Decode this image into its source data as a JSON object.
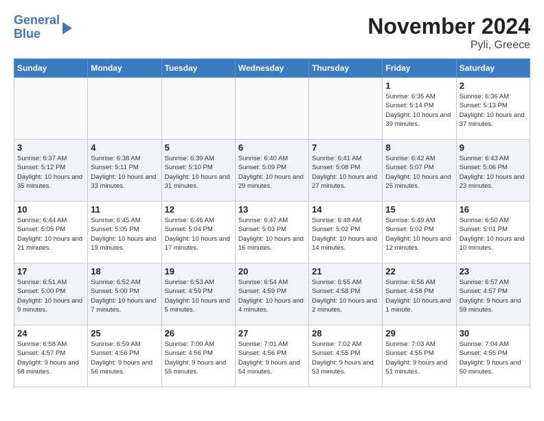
{
  "logo": {
    "line1": "General",
    "line2": "Blue"
  },
  "title": "November 2024",
  "subtitle": "Pyli, Greece",
  "days_of_week": [
    "Sunday",
    "Monday",
    "Tuesday",
    "Wednesday",
    "Thursday",
    "Friday",
    "Saturday"
  ],
  "weeks": [
    [
      {
        "day": "",
        "info": ""
      },
      {
        "day": "",
        "info": ""
      },
      {
        "day": "",
        "info": ""
      },
      {
        "day": "",
        "info": ""
      },
      {
        "day": "",
        "info": ""
      },
      {
        "day": "1",
        "info": "Sunrise: 6:35 AM\nSunset: 5:14 PM\nDaylight: 10 hours and 39 minutes."
      },
      {
        "day": "2",
        "info": "Sunrise: 6:36 AM\nSunset: 5:13 PM\nDaylight: 10 hours and 37 minutes."
      }
    ],
    [
      {
        "day": "3",
        "info": "Sunrise: 6:37 AM\nSunset: 5:12 PM\nDaylight: 10 hours and 35 minutes."
      },
      {
        "day": "4",
        "info": "Sunrise: 6:38 AM\nSunset: 5:11 PM\nDaylight: 10 hours and 33 minutes."
      },
      {
        "day": "5",
        "info": "Sunrise: 6:39 AM\nSunset: 5:10 PM\nDaylight: 10 hours and 31 minutes."
      },
      {
        "day": "6",
        "info": "Sunrise: 6:40 AM\nSunset: 5:09 PM\nDaylight: 10 hours and 29 minutes."
      },
      {
        "day": "7",
        "info": "Sunrise: 6:41 AM\nSunset: 5:08 PM\nDaylight: 10 hours and 27 minutes."
      },
      {
        "day": "8",
        "info": "Sunrise: 6:42 AM\nSunset: 5:07 PM\nDaylight: 10 hours and 25 minutes."
      },
      {
        "day": "9",
        "info": "Sunrise: 6:43 AM\nSunset: 5:06 PM\nDaylight: 10 hours and 23 minutes."
      }
    ],
    [
      {
        "day": "10",
        "info": "Sunrise: 6:44 AM\nSunset: 5:05 PM\nDaylight: 10 hours and 21 minutes."
      },
      {
        "day": "11",
        "info": "Sunrise: 6:45 AM\nSunset: 5:05 PM\nDaylight: 10 hours and 19 minutes."
      },
      {
        "day": "12",
        "info": "Sunrise: 6:46 AM\nSunset: 5:04 PM\nDaylight: 10 hours and 17 minutes."
      },
      {
        "day": "13",
        "info": "Sunrise: 6:47 AM\nSunset: 5:03 PM\nDaylight: 10 hours and 16 minutes."
      },
      {
        "day": "14",
        "info": "Sunrise: 6:48 AM\nSunset: 5:02 PM\nDaylight: 10 hours and 14 minutes."
      },
      {
        "day": "15",
        "info": "Sunrise: 6:49 AM\nSunset: 5:02 PM\nDaylight: 10 hours and 12 minutes."
      },
      {
        "day": "16",
        "info": "Sunrise: 6:50 AM\nSunset: 5:01 PM\nDaylight: 10 hours and 10 minutes."
      }
    ],
    [
      {
        "day": "17",
        "info": "Sunrise: 6:51 AM\nSunset: 5:00 PM\nDaylight: 10 hours and 9 minutes."
      },
      {
        "day": "18",
        "info": "Sunrise: 6:52 AM\nSunset: 5:00 PM\nDaylight: 10 hours and 7 minutes."
      },
      {
        "day": "19",
        "info": "Sunrise: 6:53 AM\nSunset: 4:59 PM\nDaylight: 10 hours and 5 minutes."
      },
      {
        "day": "20",
        "info": "Sunrise: 6:54 AM\nSunset: 4:59 PM\nDaylight: 10 hours and 4 minutes."
      },
      {
        "day": "21",
        "info": "Sunrise: 6:55 AM\nSunset: 4:58 PM\nDaylight: 10 hours and 2 minutes."
      },
      {
        "day": "22",
        "info": "Sunrise: 6:56 AM\nSunset: 4:58 PM\nDaylight: 10 hours and 1 minute."
      },
      {
        "day": "23",
        "info": "Sunrise: 6:57 AM\nSunset: 4:57 PM\nDaylight: 9 hours and 59 minutes."
      }
    ],
    [
      {
        "day": "24",
        "info": "Sunrise: 6:58 AM\nSunset: 4:57 PM\nDaylight: 9 hours and 58 minutes."
      },
      {
        "day": "25",
        "info": "Sunrise: 6:59 AM\nSunset: 4:56 PM\nDaylight: 9 hours and 56 minutes."
      },
      {
        "day": "26",
        "info": "Sunrise: 7:00 AM\nSunset: 4:56 PM\nDaylight: 9 hours and 55 minutes."
      },
      {
        "day": "27",
        "info": "Sunrise: 7:01 AM\nSunset: 4:56 PM\nDaylight: 9 hours and 54 minutes."
      },
      {
        "day": "28",
        "info": "Sunrise: 7:02 AM\nSunset: 4:55 PM\nDaylight: 9 hours and 53 minutes."
      },
      {
        "day": "29",
        "info": "Sunrise: 7:03 AM\nSunset: 4:55 PM\nDaylight: 9 hours and 51 minutes."
      },
      {
        "day": "30",
        "info": "Sunrise: 7:04 AM\nSunset: 4:55 PM\nDaylight: 9 hours and 50 minutes."
      }
    ]
  ]
}
